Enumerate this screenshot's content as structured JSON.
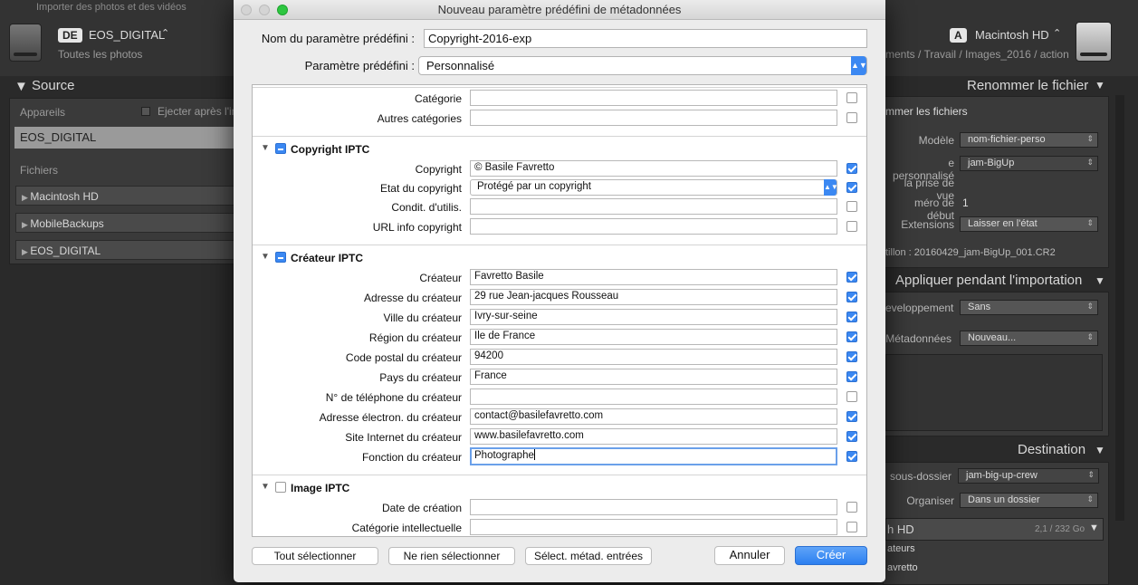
{
  "app": {
    "top_title": "Importer des photos et des vidéos",
    "source_badge": "DE",
    "source_name": "EOS_DIGITAL",
    "source_sub": "Toutes les photos",
    "dest_badge": "A",
    "dest_name": "Macintosh HD",
    "dest_path": "ments / Travail / Images_2016 / action",
    "source_panel": {
      "title": "Source",
      "devices_label": "Appareils",
      "eject_label": "Ejecter après l'im",
      "device": "EOS_DIGITAL",
      "files_label": "Fichiers",
      "volumes": [
        "Macintosh HD",
        "MobileBackups",
        "EOS_DIGITAL"
      ]
    },
    "rename_panel": {
      "title": "Renommer le fichier",
      "rename_files": "mmer les fichiers",
      "model_label": "Modèle",
      "model_value": "nom-fichier-perso",
      "custom_label": "e personnalisé",
      "custom_value": "jam-BigUp",
      "shoot_label": "la prise de vue",
      "start_label": "méro de début",
      "start_value": "1",
      "ext_label": "Extensions",
      "ext_value": "Laisser en l'état",
      "sample": "tillon :  20160429_jam-BigUp_001.CR2"
    },
    "apply_panel": {
      "title": "Appliquer pendant l'importation",
      "dev_label": "eveloppement",
      "dev_value": "Sans",
      "meta_label": "Métadonnées",
      "meta_value": "Nouveau..."
    },
    "dest_panel": {
      "title": "Destination",
      "subfolder_label": "sous-dossier",
      "subfolder_value": "jam-big-up-crew",
      "organize_label": "Organiser",
      "organize_value": "Dans un dossier",
      "disk": "h HD",
      "disk_size": "2,1 / 232 Go",
      "item1": "ateurs",
      "item2": "avretto"
    }
  },
  "dialog": {
    "title": "Nouveau paramètre prédéfini de métadonnées",
    "preset_name_label": "Nom du paramètre prédéfini :",
    "preset_name_value": "Copyright-2016-exp",
    "preset_label": "Paramètre prédéfini :",
    "preset_value": "Personnalisé",
    "top_rows": [
      {
        "label": "Catégorie",
        "value": "",
        "checked": false
      },
      {
        "label": "Autres catégories",
        "value": "",
        "checked": false
      }
    ],
    "copyright_section": {
      "title": "Copyright IPTC",
      "rows": [
        {
          "label": "Copyright",
          "value": "© Basile Favretto",
          "checked": true
        },
        {
          "label": "Etat du copyright",
          "value": "Protégé par un copyright",
          "checked": true
        },
        {
          "label": "Condit. d'utilis.",
          "value": "",
          "checked": false
        },
        {
          "label": "URL info copyright",
          "value": "",
          "checked": false
        }
      ]
    },
    "creator_section": {
      "title": "Créateur IPTC",
      "rows": [
        {
          "label": "Créateur",
          "value": "Favretto Basile",
          "checked": true
        },
        {
          "label": "Adresse du créateur",
          "value": "29 rue Jean-jacques Rousseau",
          "checked": true
        },
        {
          "label": "Ville du créateur",
          "value": "Ivry-sur-seine",
          "checked": true
        },
        {
          "label": "Région du créateur",
          "value": "Ile de France",
          "checked": true
        },
        {
          "label": "Code postal du créateur",
          "value": "94200",
          "checked": true
        },
        {
          "label": "Pays du créateur",
          "value": "France",
          "checked": true
        },
        {
          "label": "N° de téléphone du créateur",
          "value": "",
          "checked": false
        },
        {
          "label": "Adresse électron. du créateur",
          "value": "contact@basilefavretto.com",
          "checked": true
        },
        {
          "label": "Site Internet du créateur",
          "value": "www.basilefavretto.com",
          "checked": true
        },
        {
          "label": "Fonction du créateur",
          "value": "Photographe",
          "checked": true
        }
      ]
    },
    "image_section": {
      "title": "Image IPTC",
      "rows": [
        {
          "label": "Date de création",
          "value": "",
          "checked": false
        },
        {
          "label": "Catégorie intellectuelle",
          "value": "",
          "checked": false
        }
      ]
    },
    "buttons": {
      "select_all": "Tout sélectionner",
      "select_none": "Ne rien sélectionner",
      "select_entered": "Sélect. métad. entrées",
      "cancel": "Annuler",
      "create": "Créer"
    }
  }
}
